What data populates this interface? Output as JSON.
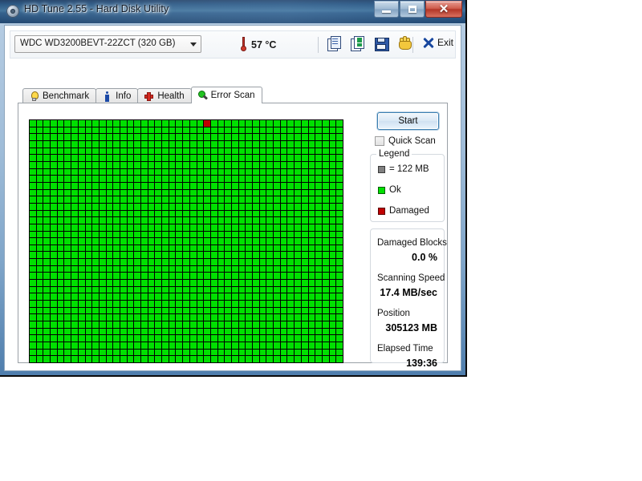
{
  "window": {
    "title": "HD Tune 2.55 - Hard Disk Utility",
    "icon": "disk-platter-icon",
    "buttons": {
      "minimize": "–",
      "maximize": "□",
      "close": "✕"
    }
  },
  "toolbar": {
    "drive": {
      "selected": "WDC WD3200BEVT-22ZCT (320 GB)",
      "options": [
        "WDC WD3200BEVT-22ZCT (320 GB)"
      ]
    },
    "temperature": "57 °C",
    "icons": [
      "copy-icon",
      "copy-to-sheet-icon",
      "save-icon",
      "hand-icon"
    ],
    "exit_label": "Exit"
  },
  "tabs": [
    {
      "label": "Benchmark",
      "icon": "lightbulb-icon",
      "active": false
    },
    {
      "label": "Info",
      "icon": "info-icon",
      "active": false
    },
    {
      "label": "Health",
      "icon": "red-cross-icon",
      "active": false
    },
    {
      "label": "Error Scan",
      "icon": "magnifier-icon",
      "active": true
    }
  ],
  "scan": {
    "start_label": "Start",
    "quick_scan_label": "Quick Scan",
    "quick_scan_checked": false,
    "grid": {
      "columns": 45,
      "rows": 35,
      "ok_color": "#00e000",
      "damaged_color": "#c00000",
      "background": "#000000",
      "damaged_cells": [
        {
          "row": 0,
          "col": 25
        }
      ]
    }
  },
  "legend": {
    "title": "Legend",
    "items": [
      {
        "swatch": "gray",
        "label": "= 122 MB"
      },
      {
        "swatch": "green",
        "label": "Ok"
      },
      {
        "swatch": "red",
        "label": "Damaged"
      }
    ]
  },
  "stats": [
    {
      "label": "Damaged Blocks",
      "value": "0.0 %"
    },
    {
      "label": "Scanning Speed",
      "value": "17.4 MB/sec"
    },
    {
      "label": "Position",
      "value": "305123 MB"
    },
    {
      "label": "Elapsed Time",
      "value": "139:36"
    }
  ]
}
